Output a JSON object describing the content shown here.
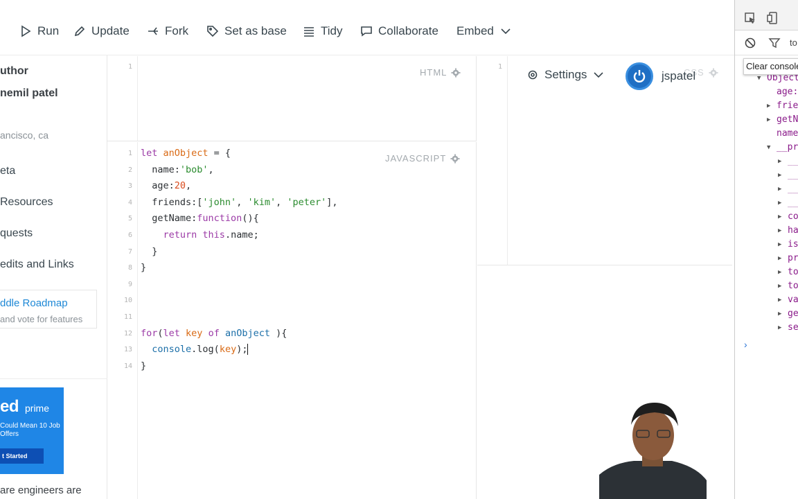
{
  "toolbar": {
    "run": "Run",
    "update": "Update",
    "fork": "Fork",
    "set_as_base": "Set as base",
    "tidy": "Tidy",
    "collaborate": "Collaborate",
    "embed": "Embed"
  },
  "sidebar": {
    "author_heading": "uthor",
    "author_name": "nemil patel",
    "location": "ancisco, ca",
    "links": [
      "eta",
      "Resources",
      "quests",
      "edits and Links"
    ],
    "roadmap_title": "ddle Roadmap",
    "roadmap_sub": "and vote for features",
    "ad_brand": "ed",
    "ad_prime": "prime",
    "ad_copy": "Could Mean 10 Job Offers",
    "ad_button": "t Started",
    "footer_text": "are engineers are"
  },
  "html_panel": {
    "label": "HTML",
    "line_numbers": [
      "1"
    ]
  },
  "css_panel": {
    "label": "CSS",
    "line_numbers": [
      "1"
    ]
  },
  "js_panel": {
    "label": "JAVASCRIPT",
    "line_numbers": [
      "1",
      "2",
      "3",
      "4",
      "5",
      "6",
      "7",
      "8",
      "9",
      "10",
      "11",
      "12",
      "13",
      "14"
    ]
  },
  "right_header": {
    "settings": "Settings",
    "username": "jspatel"
  },
  "devtools": {
    "filter_text": "to",
    "tooltip": "Clear console",
    "tree": [
      {
        "toggle": "▼",
        "key": "Object",
        "indent": 0
      },
      {
        "toggle": "",
        "key": "age:",
        "indent": 1
      },
      {
        "toggle": "▶",
        "key": "frie",
        "indent": 1
      },
      {
        "toggle": "▶",
        "key": "getN",
        "indent": 1
      },
      {
        "toggle": "",
        "key": "name",
        "indent": 1
      },
      {
        "toggle": "▼",
        "key": "__pr",
        "indent": 1
      },
      {
        "toggle": "▶",
        "key": "__",
        "indent": 2
      },
      {
        "toggle": "▶",
        "key": "__",
        "indent": 2
      },
      {
        "toggle": "▶",
        "key": "__",
        "indent": 2
      },
      {
        "toggle": "▶",
        "key": "__",
        "indent": 2
      },
      {
        "toggle": "▶",
        "key": "co",
        "indent": 2
      },
      {
        "toggle": "▶",
        "key": "ha",
        "indent": 2
      },
      {
        "toggle": "▶",
        "key": "is",
        "indent": 2
      },
      {
        "toggle": "▶",
        "key": "pr",
        "indent": 2
      },
      {
        "toggle": "▶",
        "key": "to",
        "indent": 2
      },
      {
        "toggle": "▶",
        "key": "to",
        "indent": 2
      },
      {
        "toggle": "▶",
        "key": "va",
        "indent": 2
      },
      {
        "toggle": "▶",
        "key": "ge",
        "indent": 2
      },
      {
        "toggle": "▶",
        "key": "se",
        "indent": 2
      }
    ],
    "prompt": "›"
  },
  "code": [
    [
      [
        "kw",
        "let "
      ],
      [
        "vr",
        "anObject"
      ],
      [
        "pl",
        " = {"
      ]
    ],
    [
      [
        "pl",
        "  name:"
      ],
      [
        "st",
        "'bob'"
      ],
      [
        "pl",
        ","
      ]
    ],
    [
      [
        "pl",
        "  age:"
      ],
      [
        "nm",
        "20"
      ],
      [
        "pl",
        ","
      ]
    ],
    [
      [
        "pl",
        "  friends:["
      ],
      [
        "st",
        "'john'"
      ],
      [
        "pl",
        ", "
      ],
      [
        "st",
        "'kim'"
      ],
      [
        "pl",
        ", "
      ],
      [
        "st",
        "'peter'"
      ],
      [
        "pl",
        "],"
      ]
    ],
    [
      [
        "pl",
        "  getName:"
      ],
      [
        "kw",
        "function"
      ],
      [
        "pl",
        "(){"
      ]
    ],
    [
      [
        "pl",
        "    "
      ],
      [
        "kw",
        "return "
      ],
      [
        "kw",
        "this"
      ],
      [
        "pl",
        ".name;"
      ]
    ],
    [
      [
        "pl",
        "  }"
      ]
    ],
    [
      [
        "pl",
        "}"
      ]
    ],
    [],
    [],
    [],
    [
      [
        "kw",
        "for"
      ],
      [
        "pl",
        "("
      ],
      [
        "kw",
        "let "
      ],
      [
        "vr",
        "key "
      ],
      [
        "kw",
        "of "
      ],
      [
        "fn",
        "anObject"
      ],
      [
        "pl",
        " ){"
      ]
    ],
    [
      [
        "pl",
        "  "
      ],
      [
        "fn",
        "console"
      ],
      [
        "pl",
        ".log("
      ],
      [
        "vr",
        "key"
      ],
      [
        "pl",
        ");"
      ]
    ],
    [
      [
        "pl",
        "}"
      ]
    ]
  ]
}
